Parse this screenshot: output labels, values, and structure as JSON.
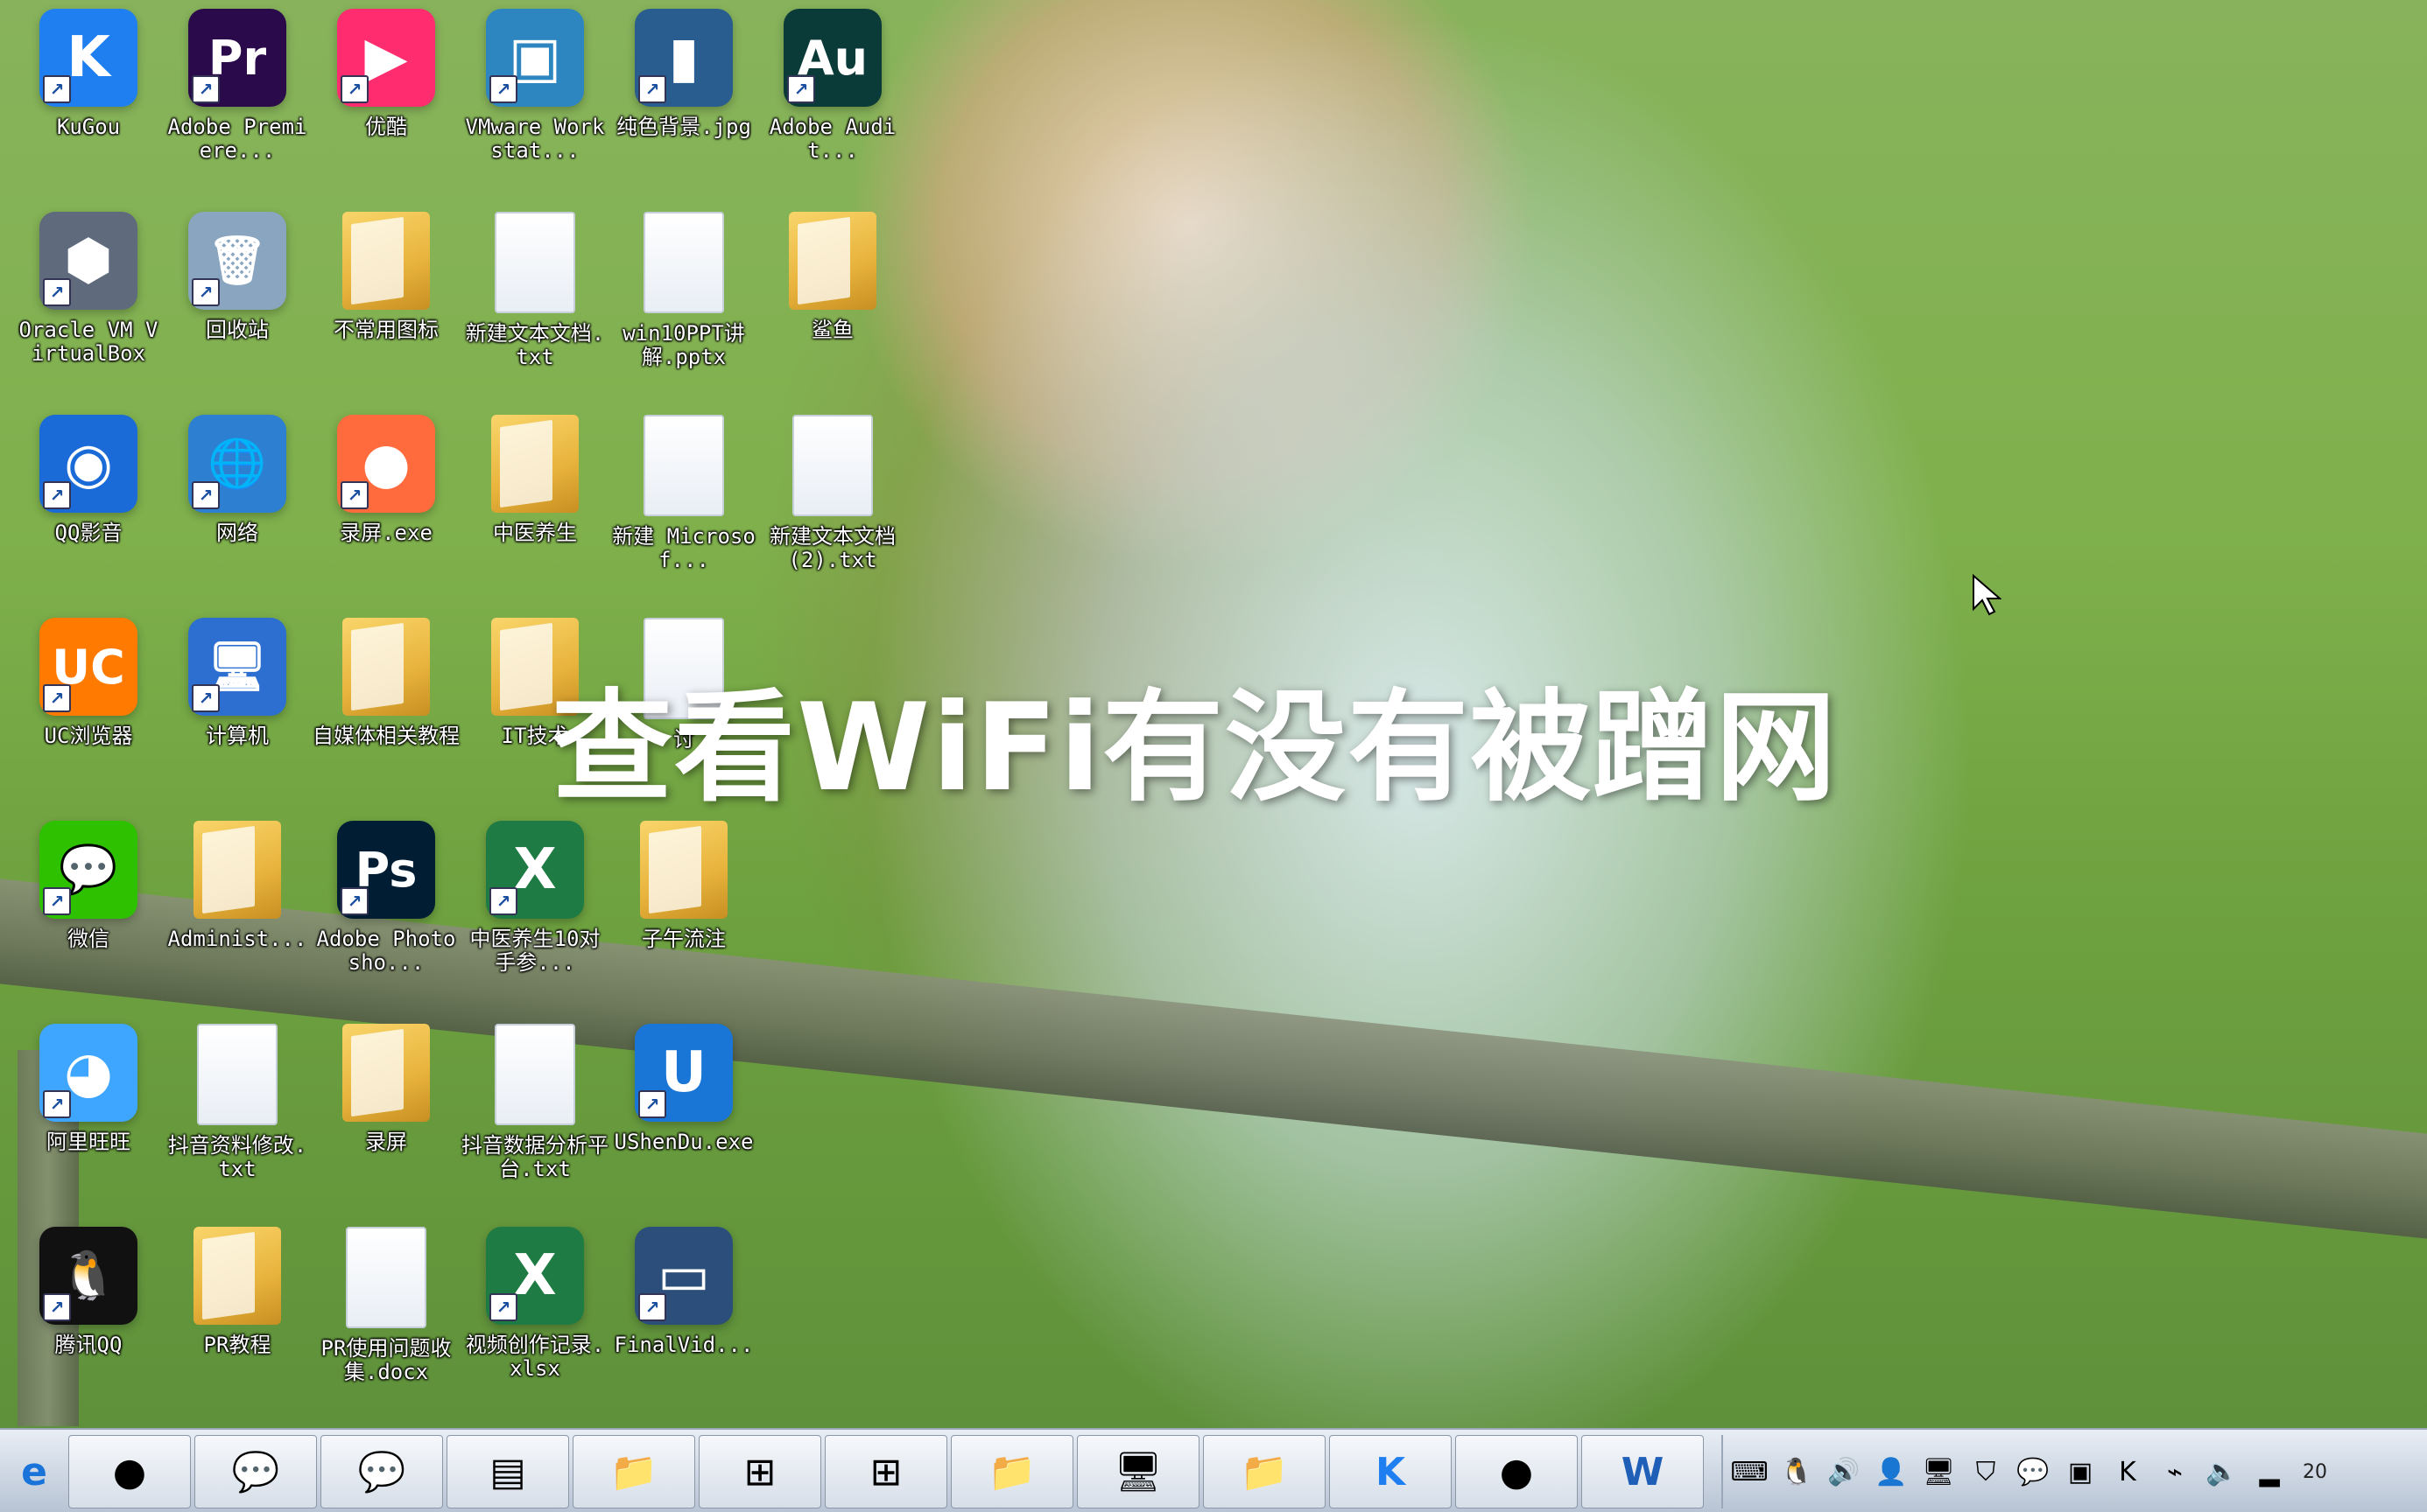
{
  "overlay": {
    "caption": "查看WiFi有没有被蹭网"
  },
  "desktop": {
    "icons": [
      {
        "label": "KuGou",
        "type": "app",
        "glyph": "K",
        "color": "#1f7ff0"
      },
      {
        "label": "Adobe Premiere...",
        "type": "app",
        "glyph": "Pr",
        "color": "#2a0a4a"
      },
      {
        "label": "优酷",
        "type": "app",
        "glyph": "▶",
        "color": "#ff2d6f"
      },
      {
        "label": "VMware Workstat...",
        "type": "app",
        "glyph": "▣",
        "color": "#2e86c1"
      },
      {
        "label": "纯色背景.jpg",
        "type": "image",
        "glyph": "▮",
        "color": "#2a5d8f"
      },
      {
        "label": "Adobe Audit...",
        "type": "app",
        "glyph": "Au",
        "color": "#0b3b39"
      },
      {
        "label": "Oracle VM VirtualBox",
        "type": "app",
        "glyph": "⬢",
        "color": "#5f6a7d"
      },
      {
        "label": "回收站",
        "type": "app",
        "glyph": "🗑",
        "color": "#8aa5c0"
      },
      {
        "label": "不常用图标",
        "type": "folder"
      },
      {
        "label": "新建文本文档.txt",
        "type": "doc"
      },
      {
        "label": "win10PPT讲解.pptx",
        "type": "doc"
      },
      {
        "label": "鲨鱼",
        "type": "folder"
      },
      {
        "label": "QQ影音",
        "type": "app",
        "glyph": "◉",
        "color": "#1a6ad8"
      },
      {
        "label": "网络",
        "type": "app",
        "glyph": "🌐",
        "color": "#2d7fd1"
      },
      {
        "label": "录屏.exe",
        "type": "app",
        "glyph": "●",
        "color": "#ff6b3d"
      },
      {
        "label": "中医养生",
        "type": "folder"
      },
      {
        "label": "新建 Microsof...",
        "type": "doc"
      },
      {
        "label": "新建文本文档 (2).txt",
        "type": "doc"
      },
      {
        "label": "UC浏览器",
        "type": "app",
        "glyph": "UC",
        "color": "#ff7a00"
      },
      {
        "label": "计算机",
        "type": "app",
        "glyph": "🖥",
        "color": "#2c6fd0"
      },
      {
        "label": "自媒体相关教程",
        "type": "folder"
      },
      {
        "label": "IT技术",
        "type": "folder"
      },
      {
        "label": "讨",
        "type": "doc"
      },
      {
        "label": "微信",
        "type": "app",
        "glyph": "💬",
        "color": "#2dc100"
      },
      {
        "label": "Administ...",
        "type": "folder"
      },
      {
        "label": "Adobe Photosho...",
        "type": "app",
        "glyph": "Ps",
        "color": "#001d34"
      },
      {
        "label": "中医养生10对手参...",
        "type": "app",
        "glyph": "X",
        "color": "#1e7b43"
      },
      {
        "label": "子午流注",
        "type": "folder"
      },
      {
        "label": "阿里旺旺",
        "type": "app",
        "glyph": "◕",
        "color": "#3ea6ff"
      },
      {
        "label": "抖音资料修改.txt",
        "type": "doc"
      },
      {
        "label": "录屏",
        "type": "folder"
      },
      {
        "label": "抖音数据分析平台.txt",
        "type": "doc"
      },
      {
        "label": "UShenDu.exe",
        "type": "app",
        "glyph": "U",
        "color": "#1a76d6"
      },
      {
        "label": "腾讯QQ",
        "type": "app",
        "glyph": "🐧",
        "color": "#111111"
      },
      {
        "label": "PR教程",
        "type": "folder"
      },
      {
        "label": "PR使用问题收集.docx",
        "type": "doc"
      },
      {
        "label": "视频创作记录.xlsx",
        "type": "app",
        "glyph": "X",
        "color": "#1e7b43"
      },
      {
        "label": "FinalVid...",
        "type": "app",
        "glyph": "▭",
        "color": "#2b4f7a"
      }
    ]
  },
  "taskbar": {
    "buttons": [
      {
        "name": "ie-icon",
        "glyph": "e"
      },
      {
        "name": "media-thumbnail-icon",
        "glyph": "●"
      },
      {
        "name": "wechat-icon",
        "glyph": "💬"
      },
      {
        "name": "wechat-icon-2",
        "glyph": "💬"
      },
      {
        "name": "window-thumbnail-icon",
        "glyph": "▤"
      },
      {
        "name": "folder-icon",
        "glyph": "📁"
      },
      {
        "name": "windows-flag-icon",
        "glyph": "⊞"
      },
      {
        "name": "windows-flag-icon-2",
        "glyph": "⊞"
      },
      {
        "name": "folder-icon-2",
        "glyph": "📁"
      },
      {
        "name": "computer-icon",
        "glyph": "🖥"
      },
      {
        "name": "folder-icon-3",
        "glyph": "📁"
      },
      {
        "name": "kugou-icon",
        "glyph": "K"
      },
      {
        "name": "screen-recorder-icon",
        "glyph": "●"
      },
      {
        "name": "word-doc-icon",
        "glyph": "W"
      }
    ],
    "tray": [
      {
        "name": "keyboard-icon",
        "glyph": "⌨"
      },
      {
        "name": "qq-tray-icon",
        "glyph": "🐧"
      },
      {
        "name": "speaker-icon",
        "glyph": "🔊"
      },
      {
        "name": "user-tray-icon",
        "glyph": "👤"
      },
      {
        "name": "monitor-tray-icon",
        "glyph": "🖥"
      },
      {
        "name": "shield-icon",
        "glyph": "⛉"
      },
      {
        "name": "wechat-tray-icon",
        "glyph": "💬"
      },
      {
        "name": "orange-app-tray-icon",
        "glyph": "▣"
      },
      {
        "name": "kugou-tray-icon",
        "glyph": "K"
      },
      {
        "name": "usb-icon",
        "glyph": "⌁"
      },
      {
        "name": "volume-icon",
        "glyph": "🔈"
      },
      {
        "name": "signal-icon",
        "glyph": "▂"
      }
    ],
    "clock_text": "20"
  }
}
